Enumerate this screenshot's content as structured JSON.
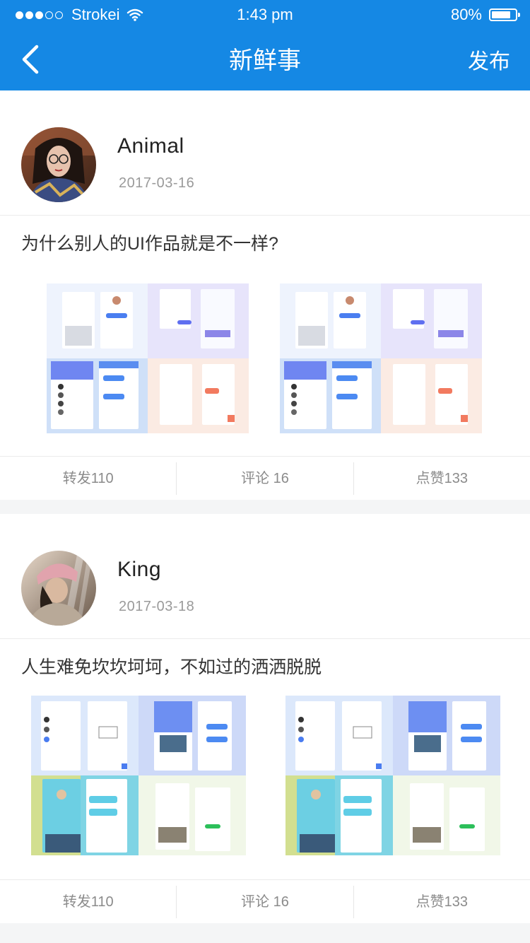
{
  "status_bar": {
    "carrier": "Strokei",
    "time": "1:43 pm",
    "battery": "80%",
    "battery_level": 0.8
  },
  "navbar": {
    "back_icon": "chevron-left-icon",
    "title": "新鲜事",
    "publish_label": "发布"
  },
  "posts": [
    {
      "author": "Animal",
      "date": "2017-03-16",
      "text": "为什么别人的UI作品就是不一样?",
      "actions": {
        "repost": "转发110",
        "comment": "评论 16",
        "like": "点赞133"
      }
    },
    {
      "author": "King",
      "date": "2017-03-18",
      "text": "人生难免坎坎坷坷，不如过的洒洒脱脱",
      "actions": {
        "repost": "转发110",
        "comment": "评论 16",
        "like": "点赞133"
      }
    }
  ],
  "colors": {
    "accent": "#1588e4",
    "text_secondary": "#8b8b8b"
  }
}
